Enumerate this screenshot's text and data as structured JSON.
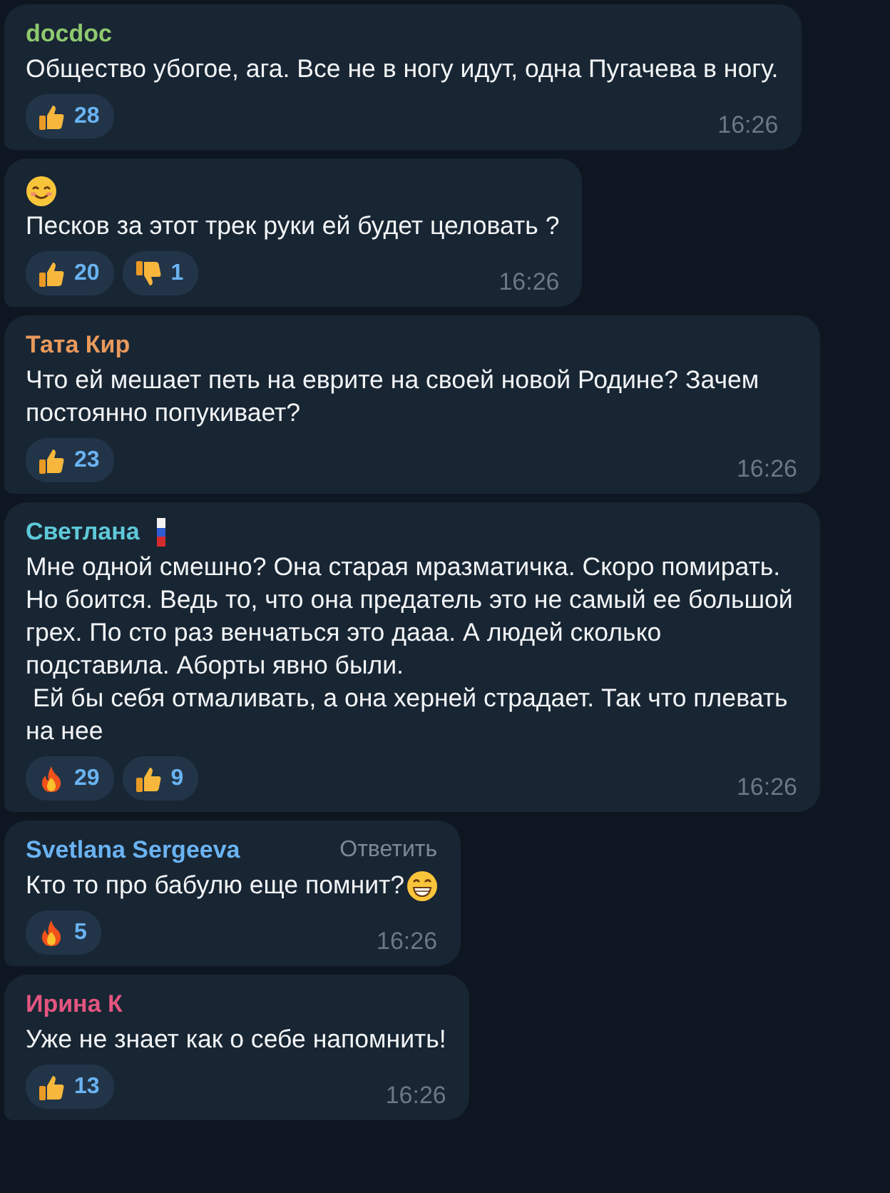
{
  "messages": [
    {
      "author": "docdoc",
      "color": "#8fc96e",
      "text": "Общество убогое, ага. Все не в ногу идут, одна Пугачева в ногу.",
      "reactions": [
        {
          "kind": "thumbs_up",
          "count": "28"
        }
      ],
      "time": "16:26"
    },
    {
      "leading_icon": true,
      "text": "Песков за этот трек руки ей будет целовать ?",
      "reactions": [
        {
          "kind": "thumbs_up",
          "count": "20"
        },
        {
          "kind": "thumbs_down",
          "count": "1"
        }
      ],
      "time": "16:26"
    },
    {
      "author": "Тата Кир",
      "color": "#e99a5c",
      "text": "Что ей мешает петь на еврите на своей новой Родине? Зачем постоянно попукивает?",
      "reactions": [
        {
          "kind": "thumbs_up",
          "count": "23"
        }
      ],
      "time": "16:26"
    },
    {
      "author": "Светлана",
      "color": "#5ec9d8",
      "author_flag": true,
      "text": "Мне одной смешно? Она старая мразматичка. Скоро помирать. Но боится. Ведь то, что она предатель это не самый ее большой грех. По сто раз венчаться это дааа. А людей сколько подставила. Аборты явно были.\n Ей бы себя отмаливать, а она херней страдает. Так что плевать на нее",
      "reactions": [
        {
          "kind": "fire",
          "count": "29"
        },
        {
          "kind": "thumbs_up",
          "count": "9"
        }
      ],
      "time": "16:26"
    },
    {
      "author": "Svetlana Sergeeva",
      "color": "#6ab3f2",
      "reply_label": "Ответить",
      "text": "Кто то про бабулю еще помнит?",
      "trailing_icon": true,
      "reactions": [
        {
          "kind": "fire",
          "count": "5"
        }
      ],
      "time": "16:26"
    },
    {
      "author": "Ирина К",
      "color": "#e4557f",
      "text": "Уже не знает как о себе напомнить!",
      "reactions": [
        {
          "kind": "thumbs_up",
          "count": "13"
        }
      ],
      "time": "16:26"
    }
  ]
}
